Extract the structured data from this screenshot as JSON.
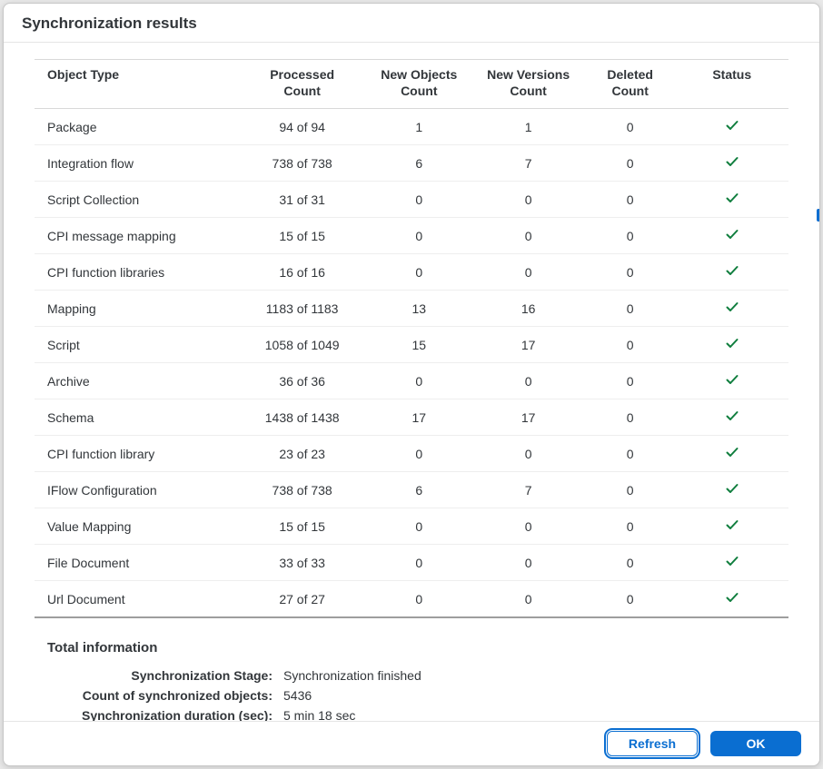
{
  "dialog": {
    "title": "Synchronization results"
  },
  "columns": {
    "objectType": "Object Type",
    "processed_l1": "Processed",
    "processed_l2": "Count",
    "newobj_l1": "New Objects",
    "newobj_l2": "Count",
    "newver_l1": "New Versions",
    "newver_l2": "Count",
    "deleted_l1": "Deleted",
    "deleted_l2": "Count",
    "status": "Status"
  },
  "rows": [
    {
      "type": "Package",
      "processed": "94 of 94",
      "new": "1",
      "ver": "1",
      "del": "0"
    },
    {
      "type": "Integration flow",
      "processed": "738 of 738",
      "new": "6",
      "ver": "7",
      "del": "0"
    },
    {
      "type": "Script Collection",
      "processed": "31 of 31",
      "new": "0",
      "ver": "0",
      "del": "0"
    },
    {
      "type": "CPI message mapping",
      "processed": "15 of 15",
      "new": "0",
      "ver": "0",
      "del": "0"
    },
    {
      "type": "CPI function libraries",
      "processed": "16 of 16",
      "new": "0",
      "ver": "0",
      "del": "0"
    },
    {
      "type": "Mapping",
      "processed": "1183 of 1183",
      "new": "13",
      "ver": "16",
      "del": "0"
    },
    {
      "type": "Script",
      "processed": "1058 of 1049",
      "new": "15",
      "ver": "17",
      "del": "0"
    },
    {
      "type": "Archive",
      "processed": "36 of 36",
      "new": "0",
      "ver": "0",
      "del": "0"
    },
    {
      "type": "Schema",
      "processed": "1438 of 1438",
      "new": "17",
      "ver": "17",
      "del": "0"
    },
    {
      "type": "CPI function library",
      "processed": "23 of 23",
      "new": "0",
      "ver": "0",
      "del": "0"
    },
    {
      "type": "IFlow Configuration",
      "processed": "738 of 738",
      "new": "6",
      "ver": "7",
      "del": "0"
    },
    {
      "type": "Value Mapping",
      "processed": "15 of 15",
      "new": "0",
      "ver": "0",
      "del": "0"
    },
    {
      "type": "File Document",
      "processed": "33 of 33",
      "new": "0",
      "ver": "0",
      "del": "0"
    },
    {
      "type": "Url Document",
      "processed": "27 of 27",
      "new": "0",
      "ver": "0",
      "del": "0"
    }
  ],
  "total": {
    "header": "Total information",
    "stage_label": "Synchronization Stage:",
    "stage_value": "Synchronization finished",
    "count_label": "Count of synchronized objects:",
    "count_value": "5436",
    "duration_label": "Synchronization duration (sec):",
    "duration_value": "5 min 18 sec"
  },
  "footer": {
    "refresh": "Refresh",
    "ok": "OK"
  }
}
